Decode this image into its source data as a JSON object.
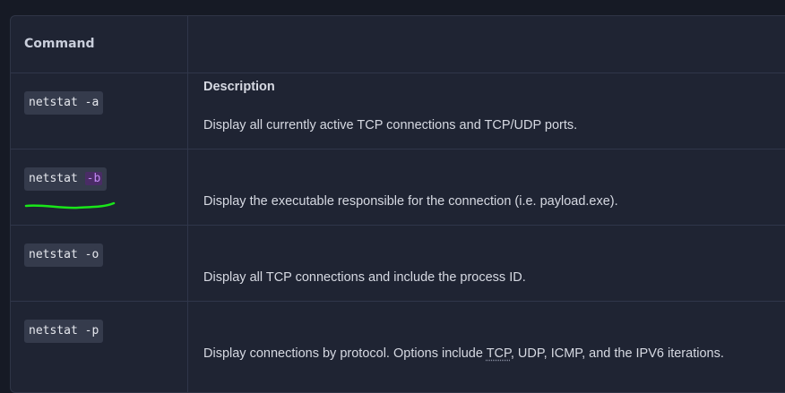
{
  "table": {
    "headers": {
      "command": "Command",
      "description": "Description"
    },
    "rows": [
      {
        "command": "netstat -a",
        "description": "Display all currently active TCP connections and TCP/UDP ports."
      },
      {
        "command_base": "netstat ",
        "command_flag": "-b",
        "description": "Display the executable responsible for the connection (i.e. payload.exe)."
      },
      {
        "command": "netstat -o",
        "description": "Display all TCP connections and include the process ID."
      },
      {
        "command": "netstat -p",
        "description_pre": "Display connections by protocol. Options include ",
        "description_abbr": "TCP",
        "description_post": ", UDP, ICMP, and the IPV6 iterations."
      }
    ]
  },
  "colors": {
    "background": "#1f2433",
    "highlight": "#c389f5",
    "annotation": "#19e619"
  }
}
